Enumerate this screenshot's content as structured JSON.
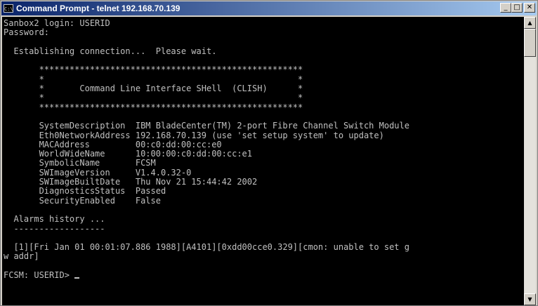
{
  "window": {
    "title": "Command Prompt - telnet 192.168.70.139",
    "icon": "console-icon",
    "buttons": {
      "minimize": "_",
      "maximize": "□",
      "close": "✕"
    }
  },
  "colors": {
    "title_gradient_start": "#0a246a",
    "title_gradient_end": "#a6caf0",
    "console_bg": "#000000",
    "console_fg": "#c0c0c0"
  },
  "terminal": {
    "lines": [
      "Sanbox2 login: USERID",
      "Password:",
      "",
      "  Establishing connection...  Please wait.",
      "",
      "       ****************************************************",
      "       *                                                  *",
      "       *       Command Line Interface SHell  (CLISH)      *",
      "       *                                                  *",
      "       ****************************************************",
      "",
      "       SystemDescription  IBM BladeCenter(TM) 2-port Fibre Channel Switch Module",
      "       Eth0NetworkAddress 192.168.70.139 (use 'set setup system' to update)",
      "       MACAddress         00:c0:dd:00:cc:e0",
      "       WorldWideName      10:00:00:c0:dd:00:cc:e1",
      "       SymbolicName       FCSM",
      "       SWImageVersion     V1.4.0.32-0",
      "       SWImageBuiltDate   Thu Nov 21 15:44:42 2002",
      "       DiagnosticsStatus  Passed",
      "       SecurityEnabled    False",
      "",
      "  Alarms history ...",
      "  ------------------",
      "",
      "  [1][Fri Jan 01 00:01:07.886 1988][A4101][0xdd00cce0.329][cmon: unable to set g",
      "w addr]",
      "",
      "FCSM: USERID> "
    ]
  }
}
